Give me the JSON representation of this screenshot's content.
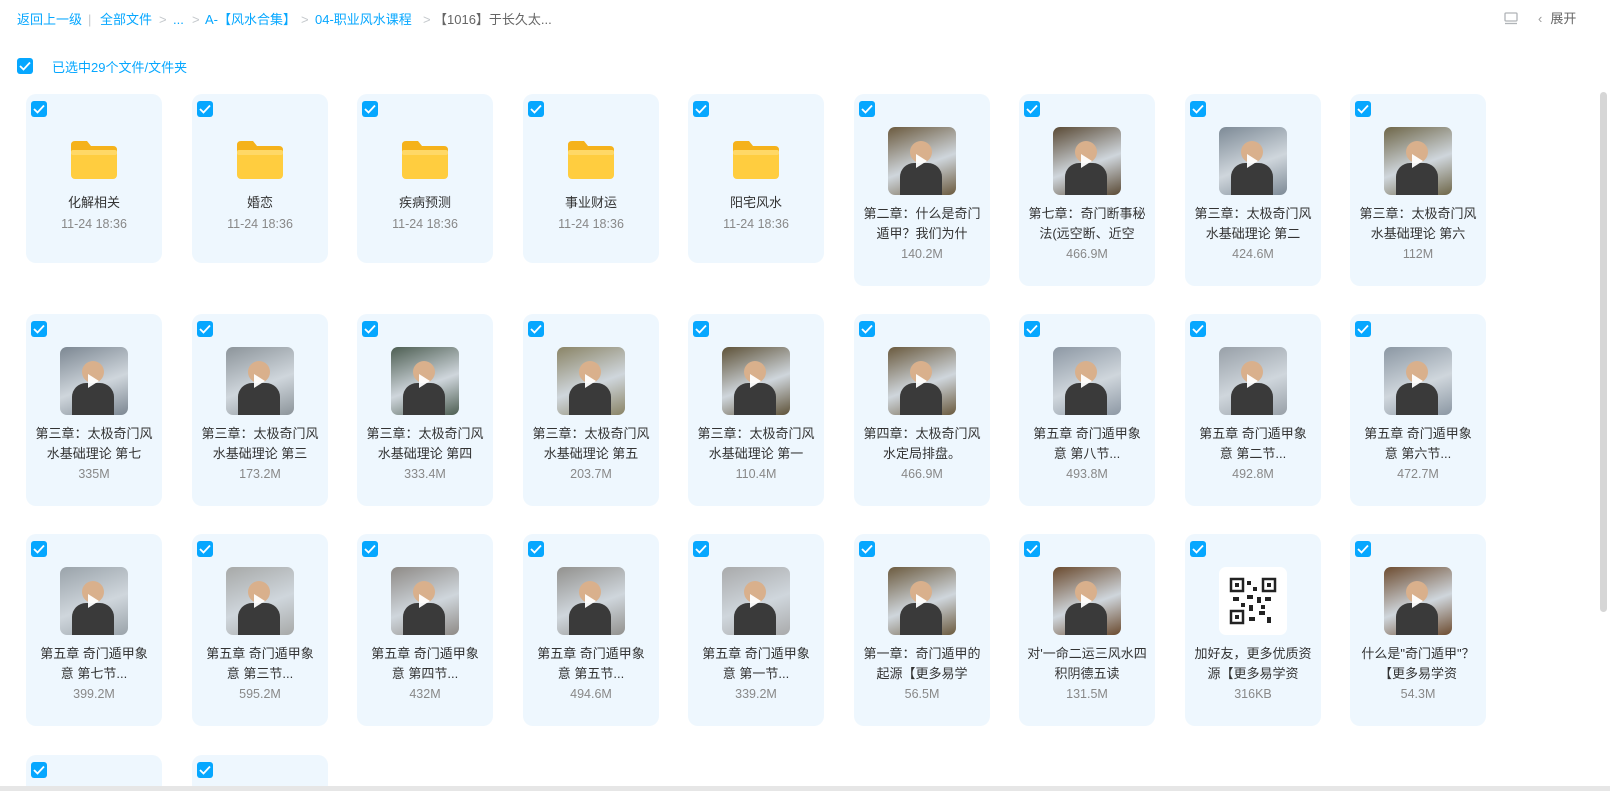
{
  "breadcrumb": {
    "back": "返回上一级",
    "items": [
      "全部文件",
      "...",
      "A-【风水合集】",
      "04-职业风水课程",
      "【1016】于长久太..."
    ]
  },
  "toolbar": {
    "expand_label": "展开"
  },
  "selection": {
    "label": "已选中29个文件/文件夹"
  },
  "row1": [
    {
      "type": "folder",
      "name": "化解相关",
      "meta": "11-24 18:36"
    },
    {
      "type": "folder",
      "name": "婚恋",
      "meta": "11-24 18:36"
    },
    {
      "type": "folder",
      "name": "疾病预测",
      "meta": "11-24 18:36"
    },
    {
      "type": "folder",
      "name": "事业财运",
      "meta": "11-24 18:36"
    },
    {
      "type": "folder",
      "name": "阳宅风水",
      "meta": "11-24 18:36"
    },
    {
      "type": "video",
      "name": "第二章：什么是奇门遁甲？我们为什",
      "meta": "140.2M",
      "thumb": "#6b5a3e"
    },
    {
      "type": "video",
      "name": "第七章：奇门断事秘法(远空断、近空",
      "meta": "466.9M",
      "thumb": "#5a4a35"
    },
    {
      "type": "video",
      "name": "第三章：太极奇门风水基础理论 第二",
      "meta": "424.6M",
      "thumb": "#7d8a96"
    },
    {
      "type": "video",
      "name": "第三章：太极奇门风水基础理论 第六",
      "meta": "112M",
      "thumb": "#6e6648"
    }
  ],
  "row2": [
    {
      "type": "video",
      "name": "第三章：太极奇门风水基础理论 第七",
      "meta": "335M",
      "thumb": "#7c8792"
    },
    {
      "type": "video",
      "name": "第三章：太极奇门风水基础理论 第三",
      "meta": "173.2M",
      "thumb": "#8c949a"
    },
    {
      "type": "video",
      "name": "第三章：太极奇门风水基础理论 第四",
      "meta": "333.4M",
      "thumb": "#4d5e52"
    },
    {
      "type": "video",
      "name": "第三章：太极奇门风水基础理论 第五",
      "meta": "203.7M",
      "thumb": "#8a8466"
    },
    {
      "type": "video",
      "name": "第三章：太极奇门风水基础理论 第一",
      "meta": "110.4M",
      "thumb": "#5e5238"
    },
    {
      "type": "video",
      "name": "第四章：太极奇门风水定局排盘。",
      "meta": "466.9M",
      "thumb": "#6a5a3e"
    },
    {
      "type": "video",
      "name": "第五章 奇门遁甲象意 第八节...",
      "meta": "493.8M",
      "thumb": "#8d98a4"
    },
    {
      "type": "video",
      "name": "第五章 奇门遁甲象意 第二节...",
      "meta": "492.8M",
      "thumb": "#98a0a8"
    },
    {
      "type": "video",
      "name": "第五章 奇门遁甲象意 第六节...",
      "meta": "472.7M",
      "thumb": "#8b97a3"
    }
  ],
  "row3": [
    {
      "type": "video",
      "name": "第五章 奇门遁甲象意 第七节...",
      "meta": "399.2M",
      "thumb": "#9aa3aa"
    },
    {
      "type": "video",
      "name": "第五章 奇门遁甲象意 第三节...",
      "meta": "595.2M",
      "thumb": "#a7a9a8"
    },
    {
      "type": "video",
      "name": "第五章 奇门遁甲象意 第四节...",
      "meta": "432M",
      "thumb": "#8e8a86"
    },
    {
      "type": "video",
      "name": "第五章 奇门遁甲象意 第五节...",
      "meta": "494.6M",
      "thumb": "#92918e"
    },
    {
      "type": "video",
      "name": "第五章 奇门遁甲象意 第一节...",
      "meta": "339.2M",
      "thumb": "#a9aaab"
    },
    {
      "type": "video",
      "name": "第一章：奇门遁甲的起源【更多易学",
      "meta": "56.5M",
      "thumb": "#6c5b3f"
    },
    {
      "type": "video",
      "name": "对'一命二运三风水四积阴德五读",
      "meta": "131.5M",
      "thumb": "#6a4a2e"
    },
    {
      "type": "qr",
      "name": "加好友，更多优质资源【更多易学资",
      "meta": "316KB",
      "thumb": "#ffffff"
    },
    {
      "type": "video",
      "name": "什么是\"奇门遁甲\"？【更多易学资",
      "meta": "54.3M",
      "thumb": "#6d4c30"
    }
  ],
  "colors": {
    "accent": "#06a7ff",
    "card_bg": "#eef7fe",
    "folder": "#ffc93c"
  }
}
